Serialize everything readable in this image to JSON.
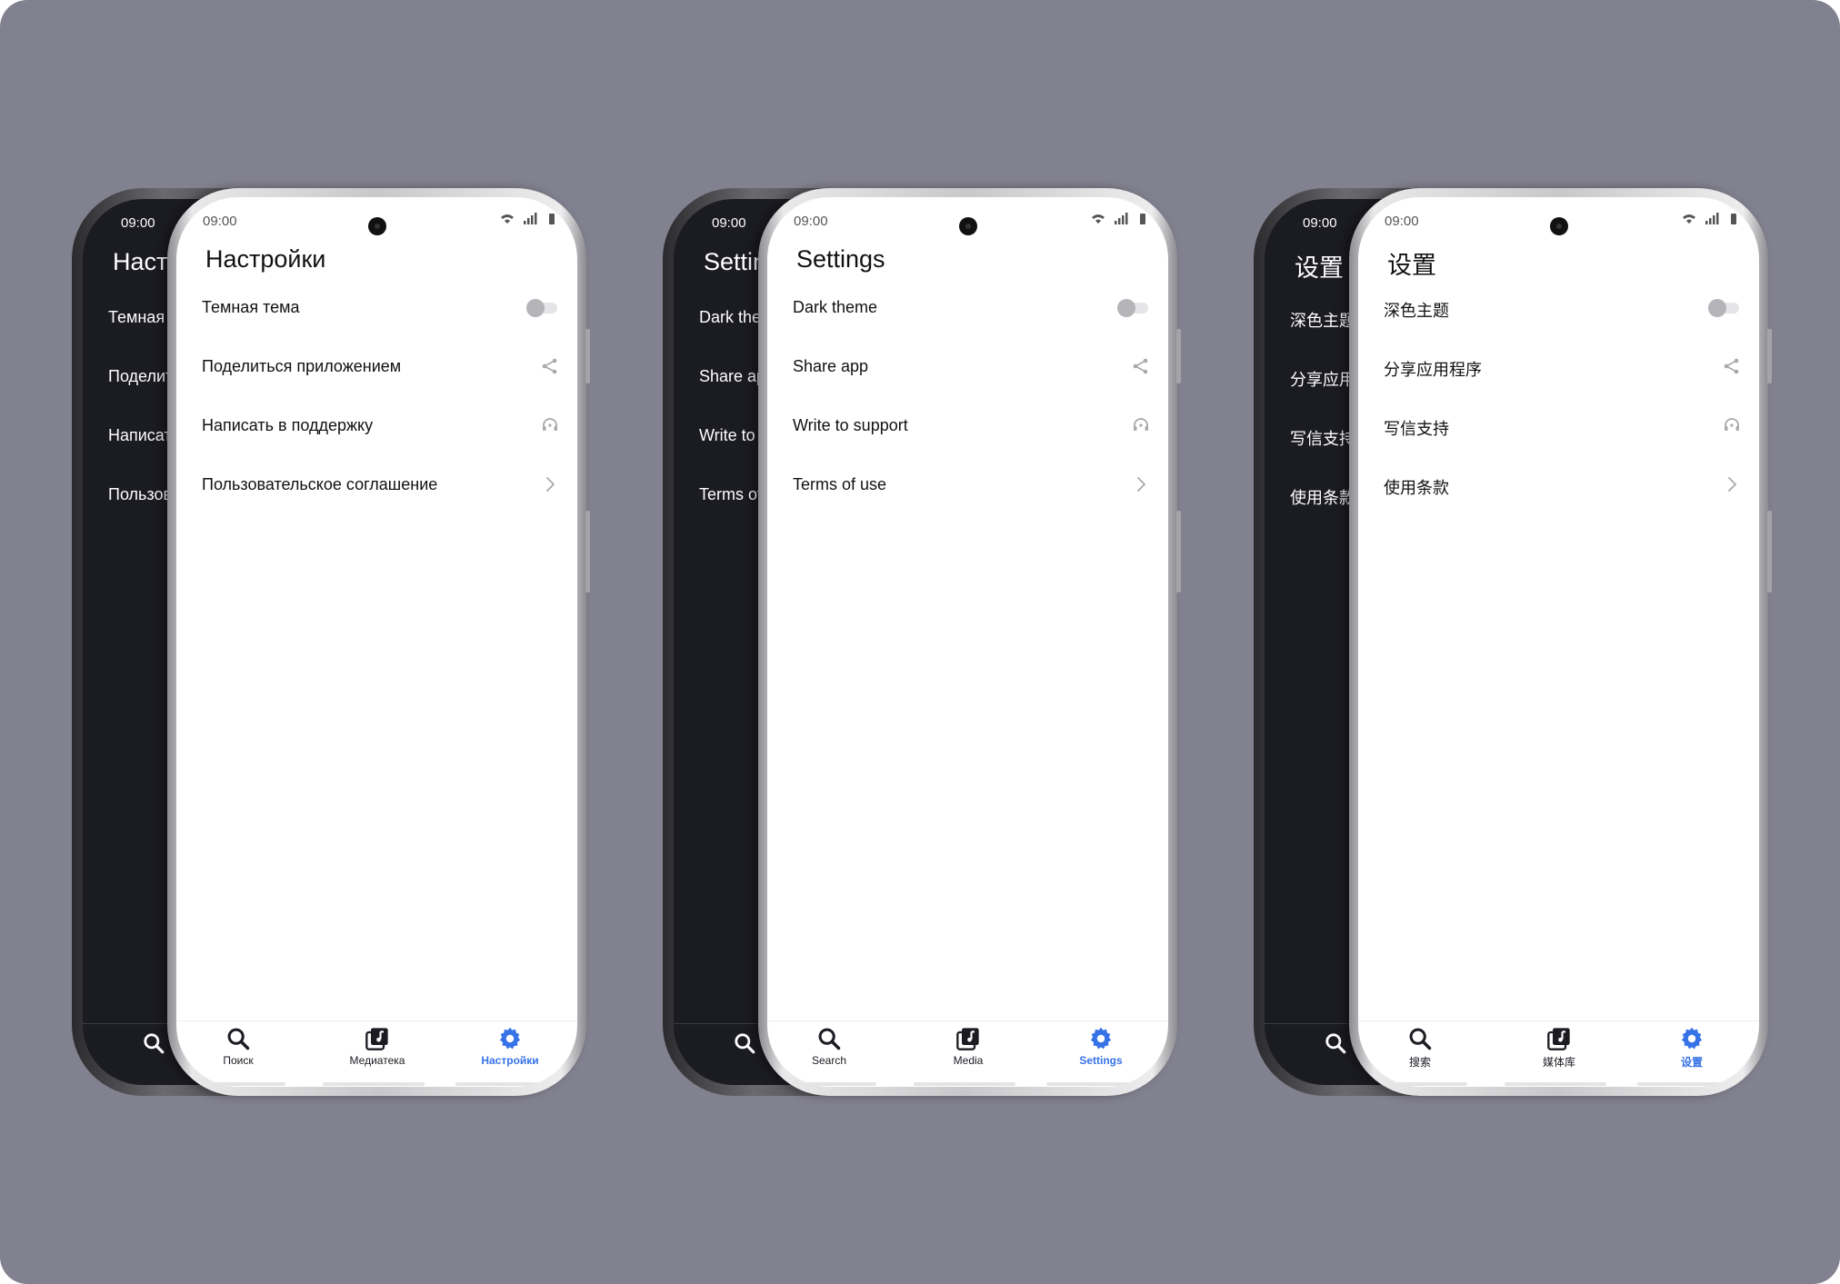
{
  "colors": {
    "background": "#82818f",
    "dark_screen": "#1b1b22",
    "accent": "#3772e7",
    "toggle_off": "#b5b5b9"
  },
  "phones": [
    {
      "locale": "ru",
      "time": "09:00",
      "title": "Настройки",
      "rows": [
        "Темная тема",
        "Поделиться приложением",
        "Написать в поддержку",
        "Пользовательское соглашение"
      ],
      "back_title": "Настр",
      "back_rows": [
        "Темная те",
        "Поделит",
        "Написать",
        "Пользова"
      ],
      "back_nav": "Поиск",
      "nav": [
        "Поиск",
        "Медиатека",
        "Настройки"
      ],
      "dark_theme_on": false
    },
    {
      "locale": "en",
      "time": "09:00",
      "title": "Settings",
      "rows": [
        "Dark theme",
        "Share app",
        "Write to support",
        "Terms of use"
      ],
      "back_title": "Settin",
      "back_rows": [
        "Dark ther",
        "Share app",
        "Write to s",
        "Terms of"
      ],
      "back_nav": "Search",
      "nav": [
        "Search",
        "Media",
        "Settings"
      ],
      "dark_theme_on": false
    },
    {
      "locale": "zh",
      "time": "09:00",
      "title": "设置",
      "rows": [
        "深色主题",
        "分享应用程序",
        "写信支持",
        "使用条款"
      ],
      "back_title": "设置",
      "back_rows": [
        "深色主题",
        "分享应用",
        "写信支持",
        "使用条款"
      ],
      "back_nav": "搜索",
      "nav": [
        "搜索",
        "媒体库",
        "设置"
      ],
      "dark_theme_on": false
    }
  ],
  "icons": {
    "row_trailing": [
      "toggle",
      "share-icon",
      "support-icon",
      "chevron-right-icon"
    ],
    "nav": [
      "search-icon",
      "media-library-icon",
      "settings-gear-icon"
    ]
  },
  "active_tab": 2
}
